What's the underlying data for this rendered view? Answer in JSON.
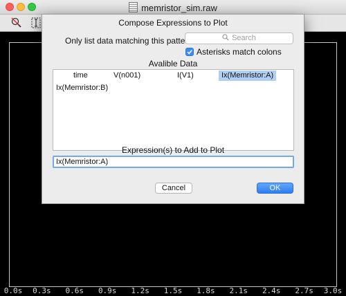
{
  "window": {
    "title": "memristor_sim.raw"
  },
  "toolbar": {
    "buttons": [
      "zoom-fit-icon",
      "cursor-icon"
    ]
  },
  "plot": {
    "x_ticks": [
      "0.0s",
      "0.3s",
      "0.6s",
      "0.9s",
      "1.2s",
      "1.5s",
      "1.8s",
      "2.1s",
      "2.4s",
      "2.7s",
      "3.0s"
    ]
  },
  "dialog": {
    "title": "Compose Expressions to Plot",
    "filter_label": "Only list data matching this pattern:",
    "search_placeholder": "Search",
    "asterisks_label": "Asterisks match colons",
    "asterisks_checked": true,
    "available_label": "Avalible Data",
    "available_data": [
      "time",
      "V(n001)",
      "I(V1)",
      "Ix(Memristor:A)",
      "Ix(Memristor:B)"
    ],
    "selected_item": "Ix(Memristor:A)",
    "expression_label": "Expression(s) to Add to Plot",
    "expression_value": "Ix(Memristor:A)",
    "cancel_label": "Cancel",
    "ok_label": "OK"
  },
  "colors": {
    "accent": "#3a8bf5",
    "selection": "#b0cff2",
    "plot_background": "#000000"
  }
}
